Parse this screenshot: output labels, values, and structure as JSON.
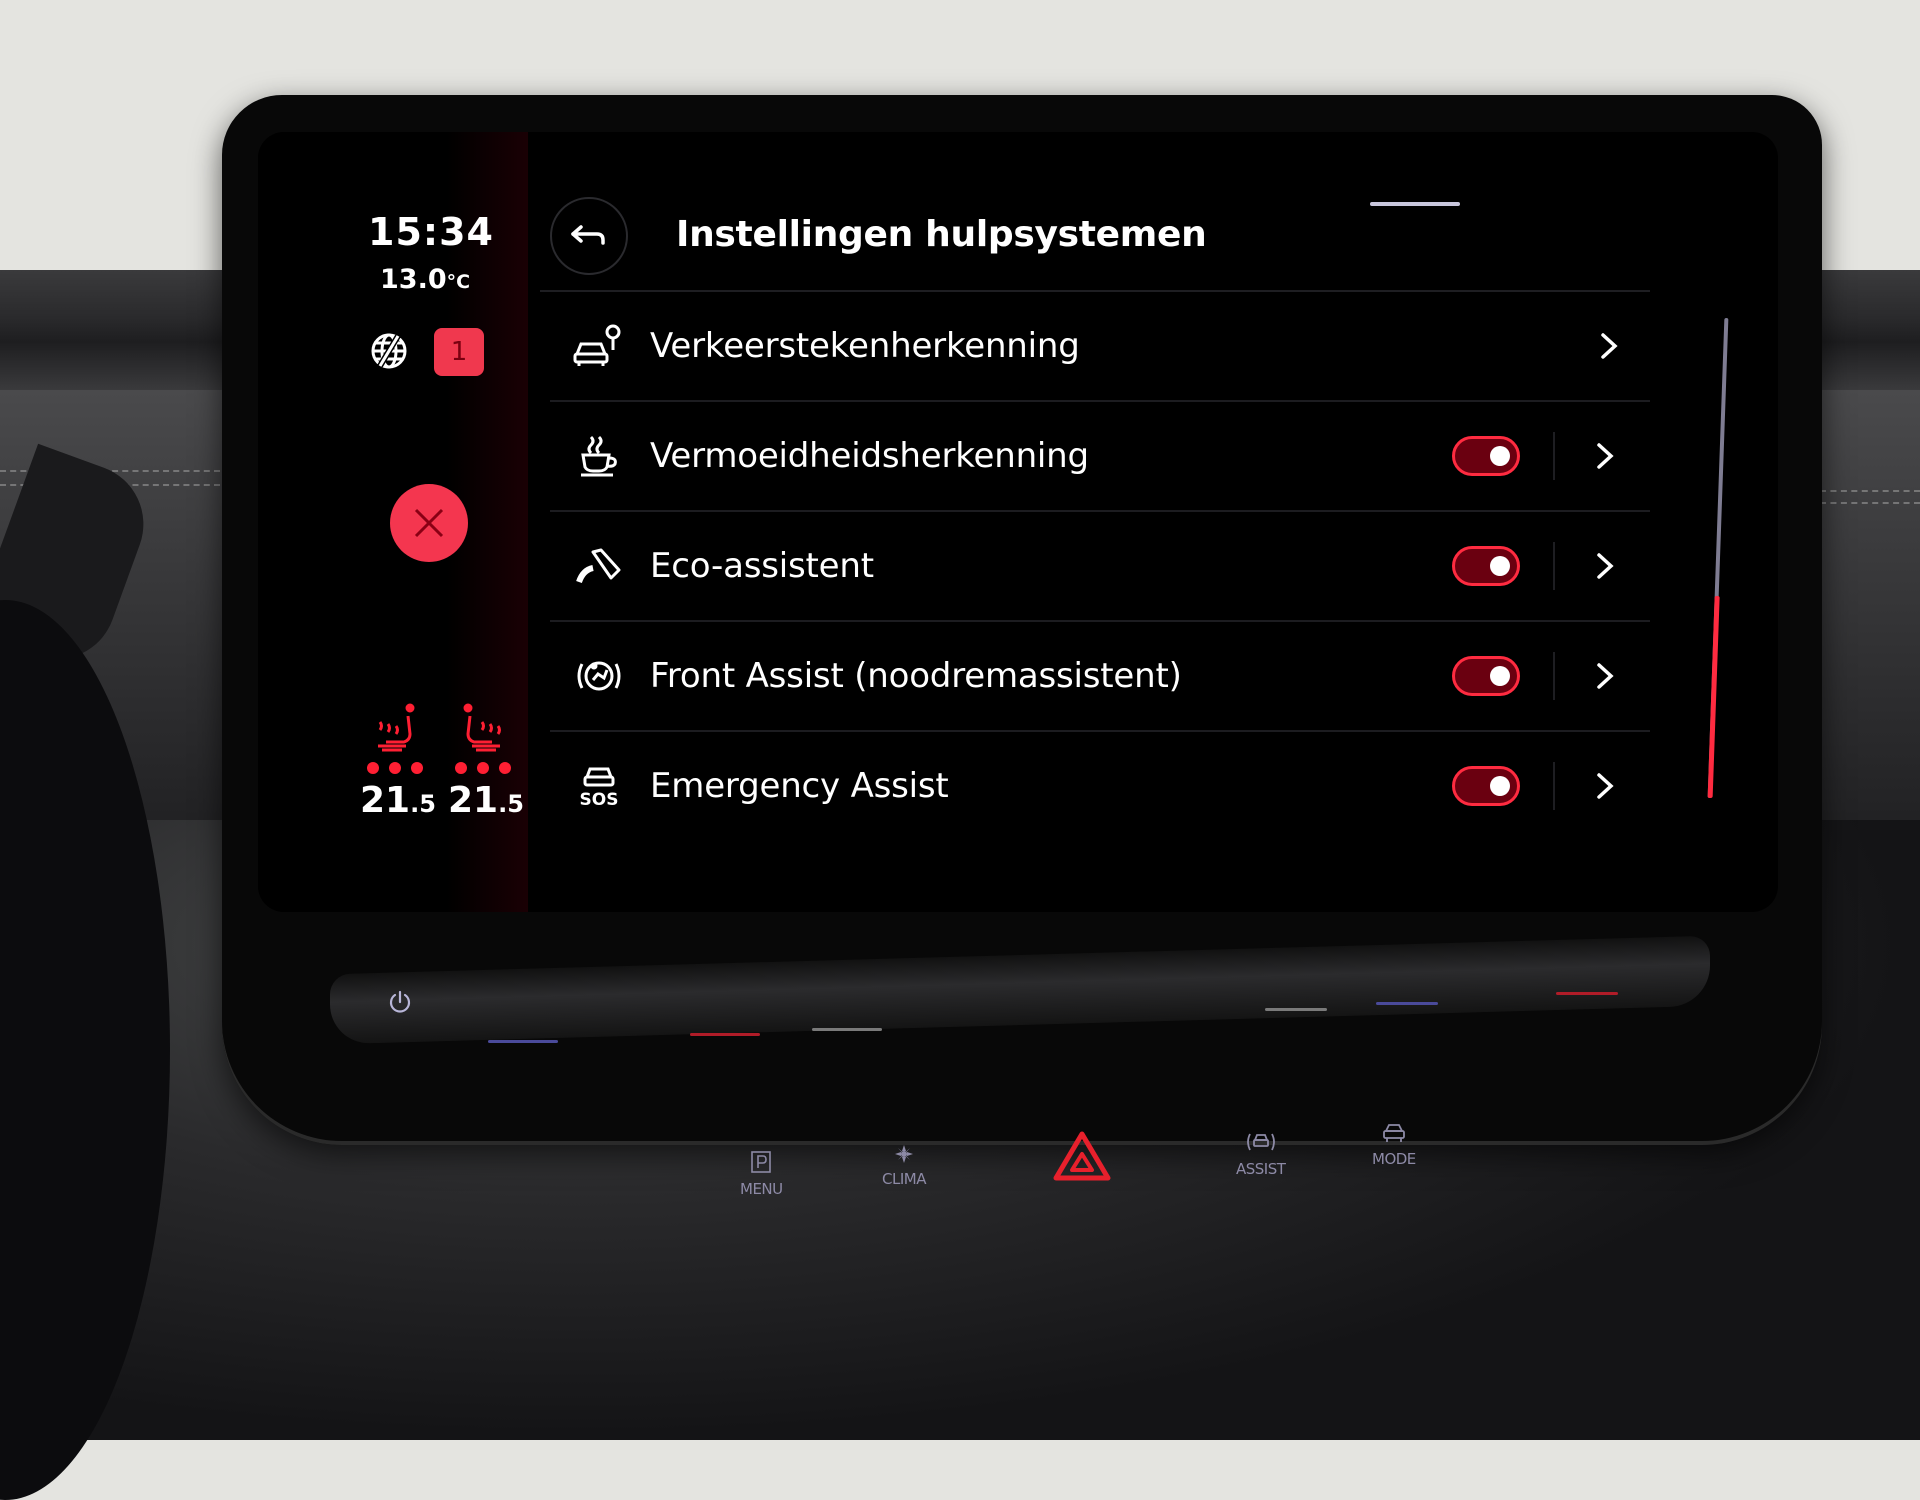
{
  "status": {
    "time": "15:34",
    "outside_temp": "13.0",
    "temp_unit": "°C",
    "notification_count": "1",
    "left_seat": {
      "temp_int": "21",
      "temp_dec": ".5",
      "heat_level": 3
    },
    "right_seat": {
      "temp_int": "21",
      "temp_dec": ".5",
      "heat_level": 3
    }
  },
  "header": {
    "title": "Instellingen hulpsystemen"
  },
  "settings": [
    {
      "label": "Verkeerstekenherkenning",
      "icon": "traffic-sign-car-icon",
      "has_toggle": false,
      "enabled": null
    },
    {
      "label": "Vermoeidheidsherkenning",
      "icon": "coffee-cup-icon",
      "has_toggle": true,
      "enabled": true
    },
    {
      "label": "Eco-assistent",
      "icon": "eco-pedal-icon",
      "has_toggle": true,
      "enabled": true
    },
    {
      "label": "Front Assist (noodremassistent)",
      "icon": "front-assist-icon",
      "has_toggle": true,
      "enabled": true
    },
    {
      "label": "Emergency Assist",
      "icon": "sos-car-icon",
      "has_toggle": true,
      "enabled": true
    }
  ],
  "scroll": {
    "position_fraction": 0.42
  },
  "hardware_buttons": [
    {
      "label": "MENU",
      "icon": "parking-p-icon"
    },
    {
      "label": "CLIMA",
      "icon": "fan-icon"
    },
    {
      "label": "",
      "icon": "hazard-triangle-icon"
    },
    {
      "label": "ASSIST",
      "icon": "assist-car-icon"
    },
    {
      "label": "MODE",
      "icon": "car-mode-icon"
    }
  ],
  "colors": {
    "accent_red": "#ff2b40",
    "badge_red": "#f0384e",
    "text": "#ffffff"
  }
}
